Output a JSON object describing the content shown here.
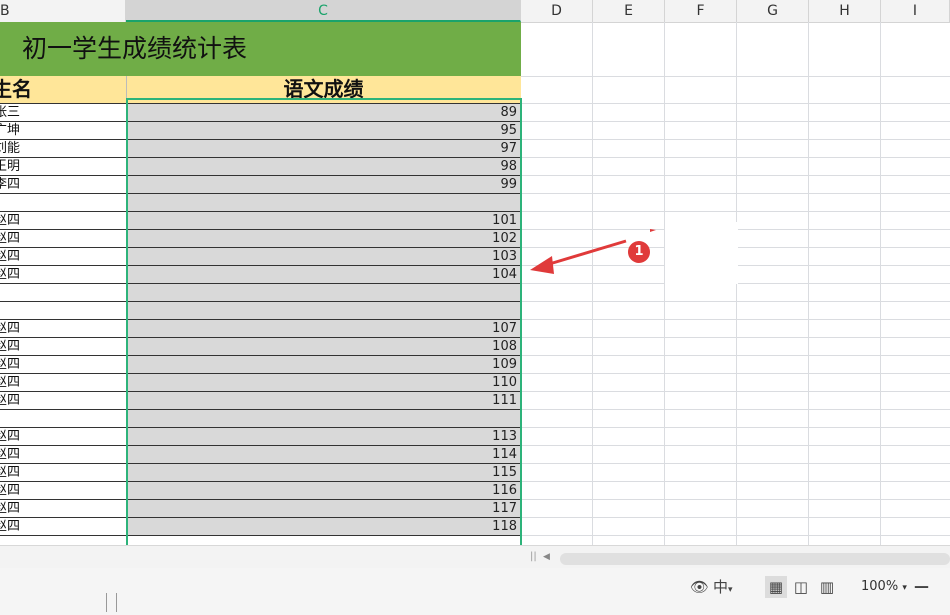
{
  "columns": [
    "B",
    "C",
    "D",
    "E",
    "F",
    "G",
    "H",
    "I"
  ],
  "title": "初一学生成绩统计表",
  "headers": {
    "name_partial": "生名",
    "chinese_score": "语文成绩"
  },
  "rows": [
    {
      "name": "张三",
      "score": "89"
    },
    {
      "name": "广坤",
      "score": "95"
    },
    {
      "name": "刘能",
      "score": "97"
    },
    {
      "name": "王明",
      "score": "98"
    },
    {
      "name": "李四",
      "score": "99"
    },
    {
      "name": "",
      "score": ""
    },
    {
      "name": "赵四",
      "score": "101"
    },
    {
      "name": "赵四",
      "score": "102"
    },
    {
      "name": "赵四",
      "score": "103"
    },
    {
      "name": "赵四",
      "score": "104"
    },
    {
      "name": "",
      "score": ""
    },
    {
      "name": "",
      "score": ""
    },
    {
      "name": "赵四",
      "score": "107"
    },
    {
      "name": "赵四",
      "score": "108"
    },
    {
      "name": "赵四",
      "score": "109"
    },
    {
      "name": "赵四",
      "score": "110"
    },
    {
      "name": "赵四",
      "score": "111"
    },
    {
      "name": "",
      "score": ""
    },
    {
      "name": "赵四",
      "score": "113"
    },
    {
      "name": "赵四",
      "score": "114"
    },
    {
      "name": "赵四",
      "score": "115"
    },
    {
      "name": "赵四",
      "score": "116"
    },
    {
      "name": "赵四",
      "score": "117"
    },
    {
      "name": "赵四",
      "score": "118"
    }
  ],
  "annotation": {
    "badge": "1"
  },
  "statusbar": {
    "zoom": "100%",
    "ime": "中",
    "eye_icon": "eye-icon"
  },
  "colors": {
    "title_bg": "#70ad47",
    "header_bg": "#ffe699",
    "selection": "#2db37a",
    "cell_gray": "#d9d9d9",
    "badge": "#e03a3a"
  }
}
